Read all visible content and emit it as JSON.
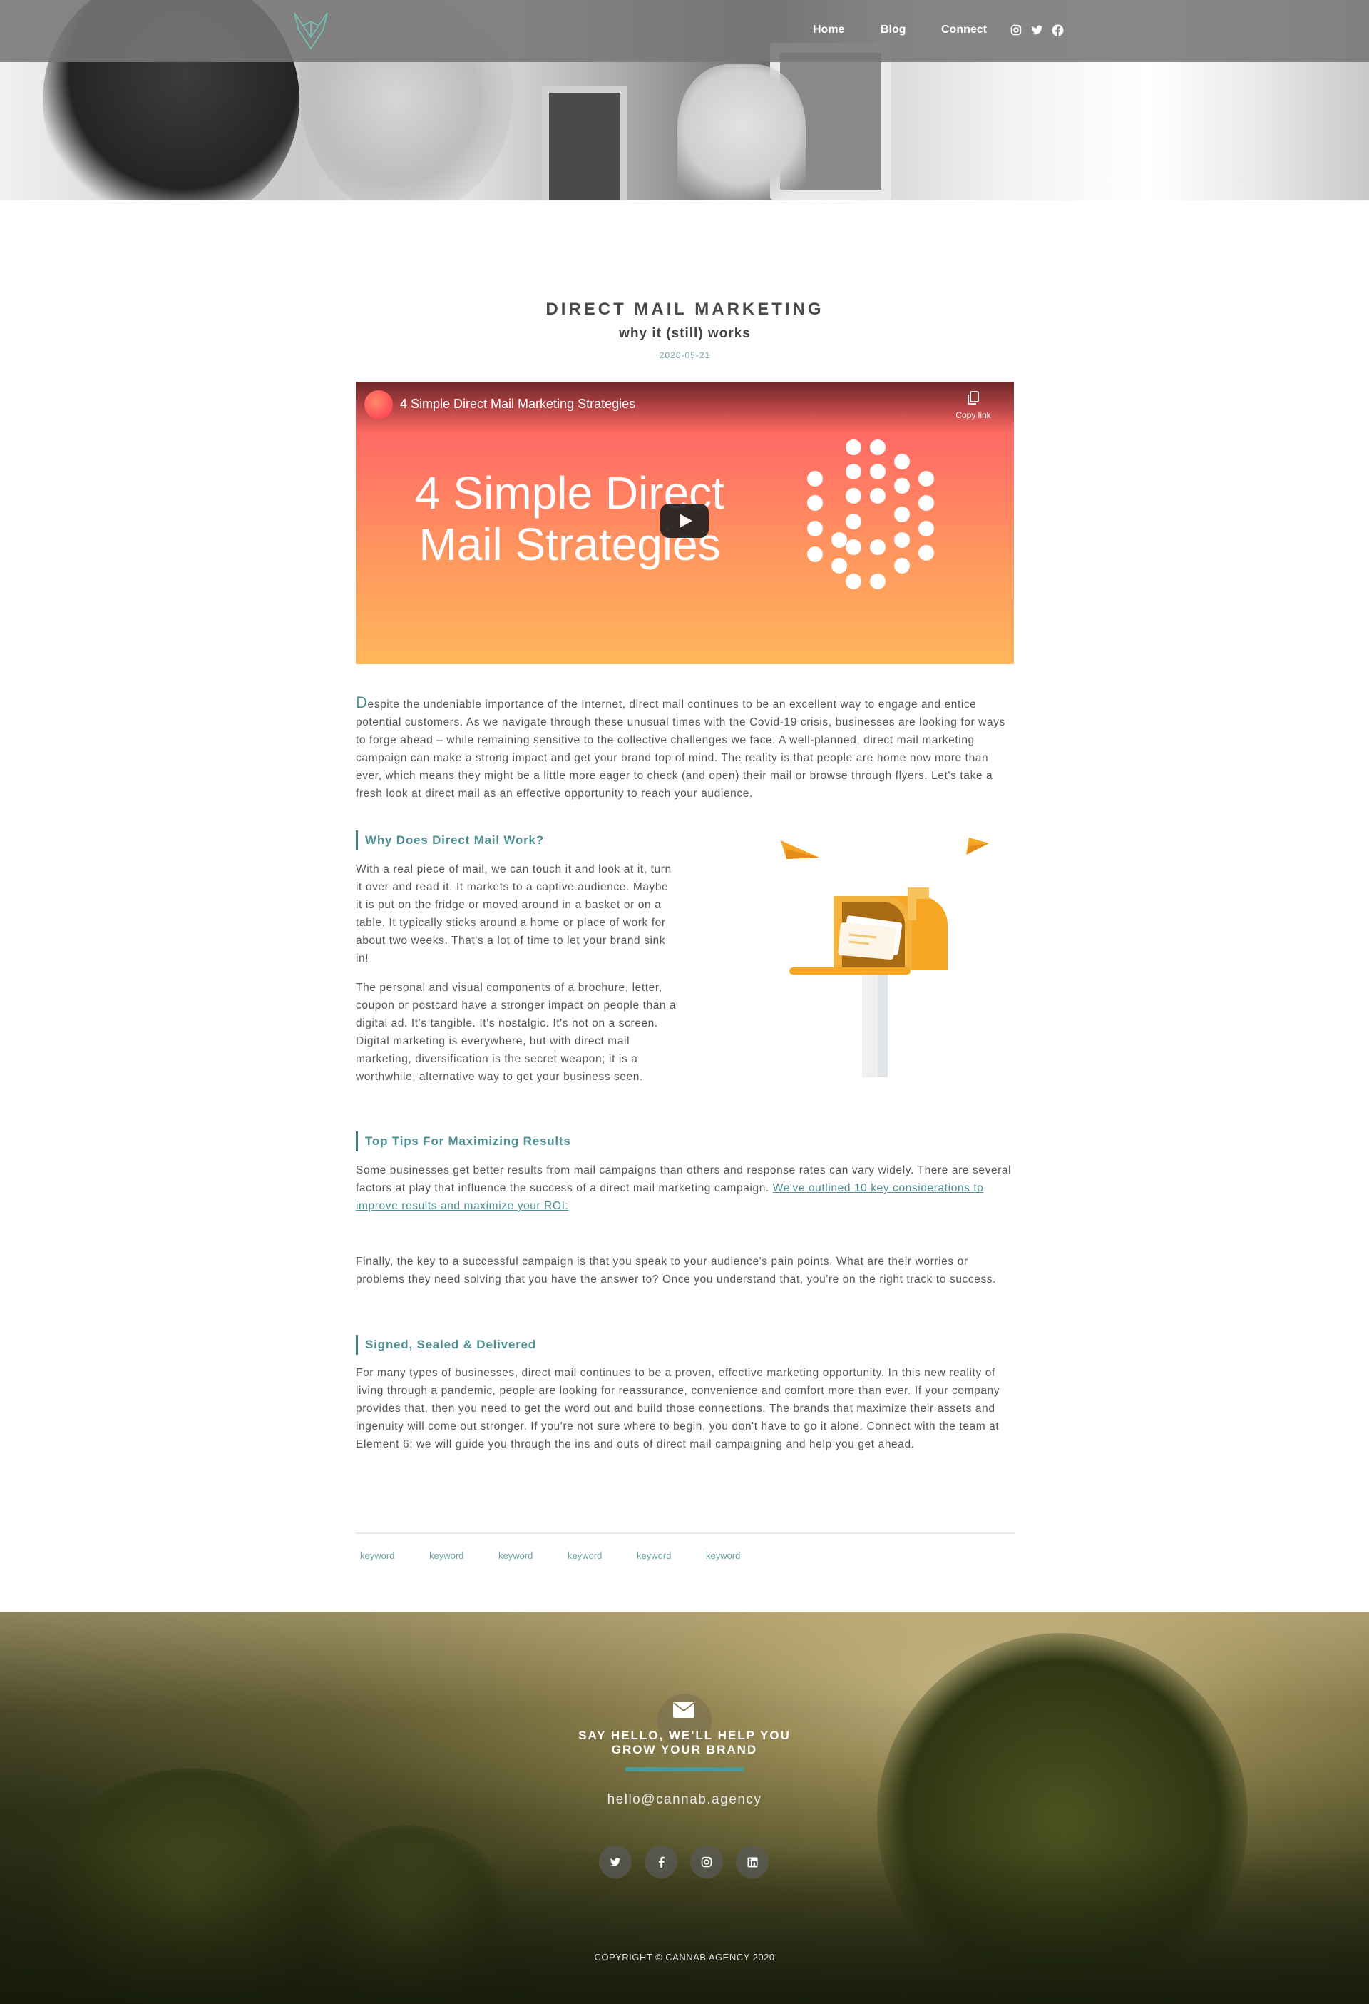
{
  "nav": {
    "links": [
      "Home",
      "Blog",
      "Connect"
    ],
    "social_icons": [
      "instagram-icon",
      "twitter-icon",
      "facebook-icon"
    ]
  },
  "post": {
    "title": "DIRECT MAIL MARKETING",
    "subtitle": "why it (still) works",
    "date": "2020-05-21"
  },
  "video": {
    "title": "4 Simple Direct Mail Marketing Strategies",
    "copy_label": "Copy link",
    "headline_line1": "4 Simple Direct",
    "headline_line2": "Mail Strategies"
  },
  "intro": {
    "dropcap": "D",
    "text": "espite the undeniable importance of the Internet, direct mail continues to be an excellent way to engage and entice potential customers. As we navigate through these unusual times with the Covid-19 crisis, businesses are looking for ways to forge ahead – while remaining sensitive to the collective challenges we face. A well-planned, direct mail marketing campaign can make a strong impact and get your brand top of mind. The reality is that people are home now more than ever, which means they might be a little more eager to check (and open) their mail or browse through flyers. Let's take a fresh look at direct mail as an effective opportunity to reach your audience."
  },
  "sections": {
    "why": {
      "heading": "Why Does Direct Mail Work?",
      "p1": "With a real piece of mail, we can touch it and look at it, turn it over and read it. It markets to a captive audience. Maybe it is put on the fridge or moved around in a basket or on a table. It typically sticks around a home or place of work for about two weeks. That's a lot of time to let your brand sink in!",
      "p2": "The personal and visual components of a brochure, letter, coupon or postcard have a stronger impact on people than a digital ad. It's tangible. It's nostalgic. It's not on a screen. Digital marketing is everywhere, but with direct mail marketing, diversification is the secret weapon; it is a worthwhile, alternative way to get your business seen."
    },
    "tips": {
      "heading": "Top Tips For Maximizing Results",
      "p1": "Some businesses get better results from mail campaigns than others and response rates can vary widely. There are several factors at play that influence the success of a direct mail marketing campaign.",
      "link": "We've outlined 10 key considerations to improve results and maximize your ROI:",
      "p2": "Finally, the key to a successful campaign is that you speak to your audience's pain points. What are their worries or problems they need solving that you have the answer to? Once you understand that, you're on the right track to success."
    },
    "signed": {
      "heading": "Signed, Sealed & Delivered",
      "p": "For many types of businesses, direct mail continues to be a proven, effective marketing opportunity. In this new reality of living through a pandemic, people are looking for reassurance, convenience and comfort more than ever. If your company provides that, then you need to get the word out and build those connections. The brands that maximize their assets and ingenuity will come out stronger. If you're not sure where to begin, you don't have to go it alone. Connect with the team at Element 6; we will guide you through the ins and outs of direct mail campaigning and help you get ahead."
    }
  },
  "keywords": [
    "keyword",
    "keyword",
    "keyword",
    "keyword",
    "keyword",
    "keyword"
  ],
  "footer": {
    "heading_line1": "SAY HELLO, WE'LL HELP YOU",
    "heading_line2": "GROW YOUR BRAND",
    "email": "hello@cannab.agency",
    "social_icons": [
      "twitter-icon",
      "facebook-icon",
      "instagram-icon",
      "linkedin-icon"
    ],
    "copyright": "COPYRIGHT © CANNAB AGENCY 2020"
  },
  "colors": {
    "accent": "#4d8f93",
    "bar": "#4d9a9b",
    "video_top": "#ff5a63",
    "video_bottom": "#ffb65a",
    "mailbox": "#f6a623"
  }
}
